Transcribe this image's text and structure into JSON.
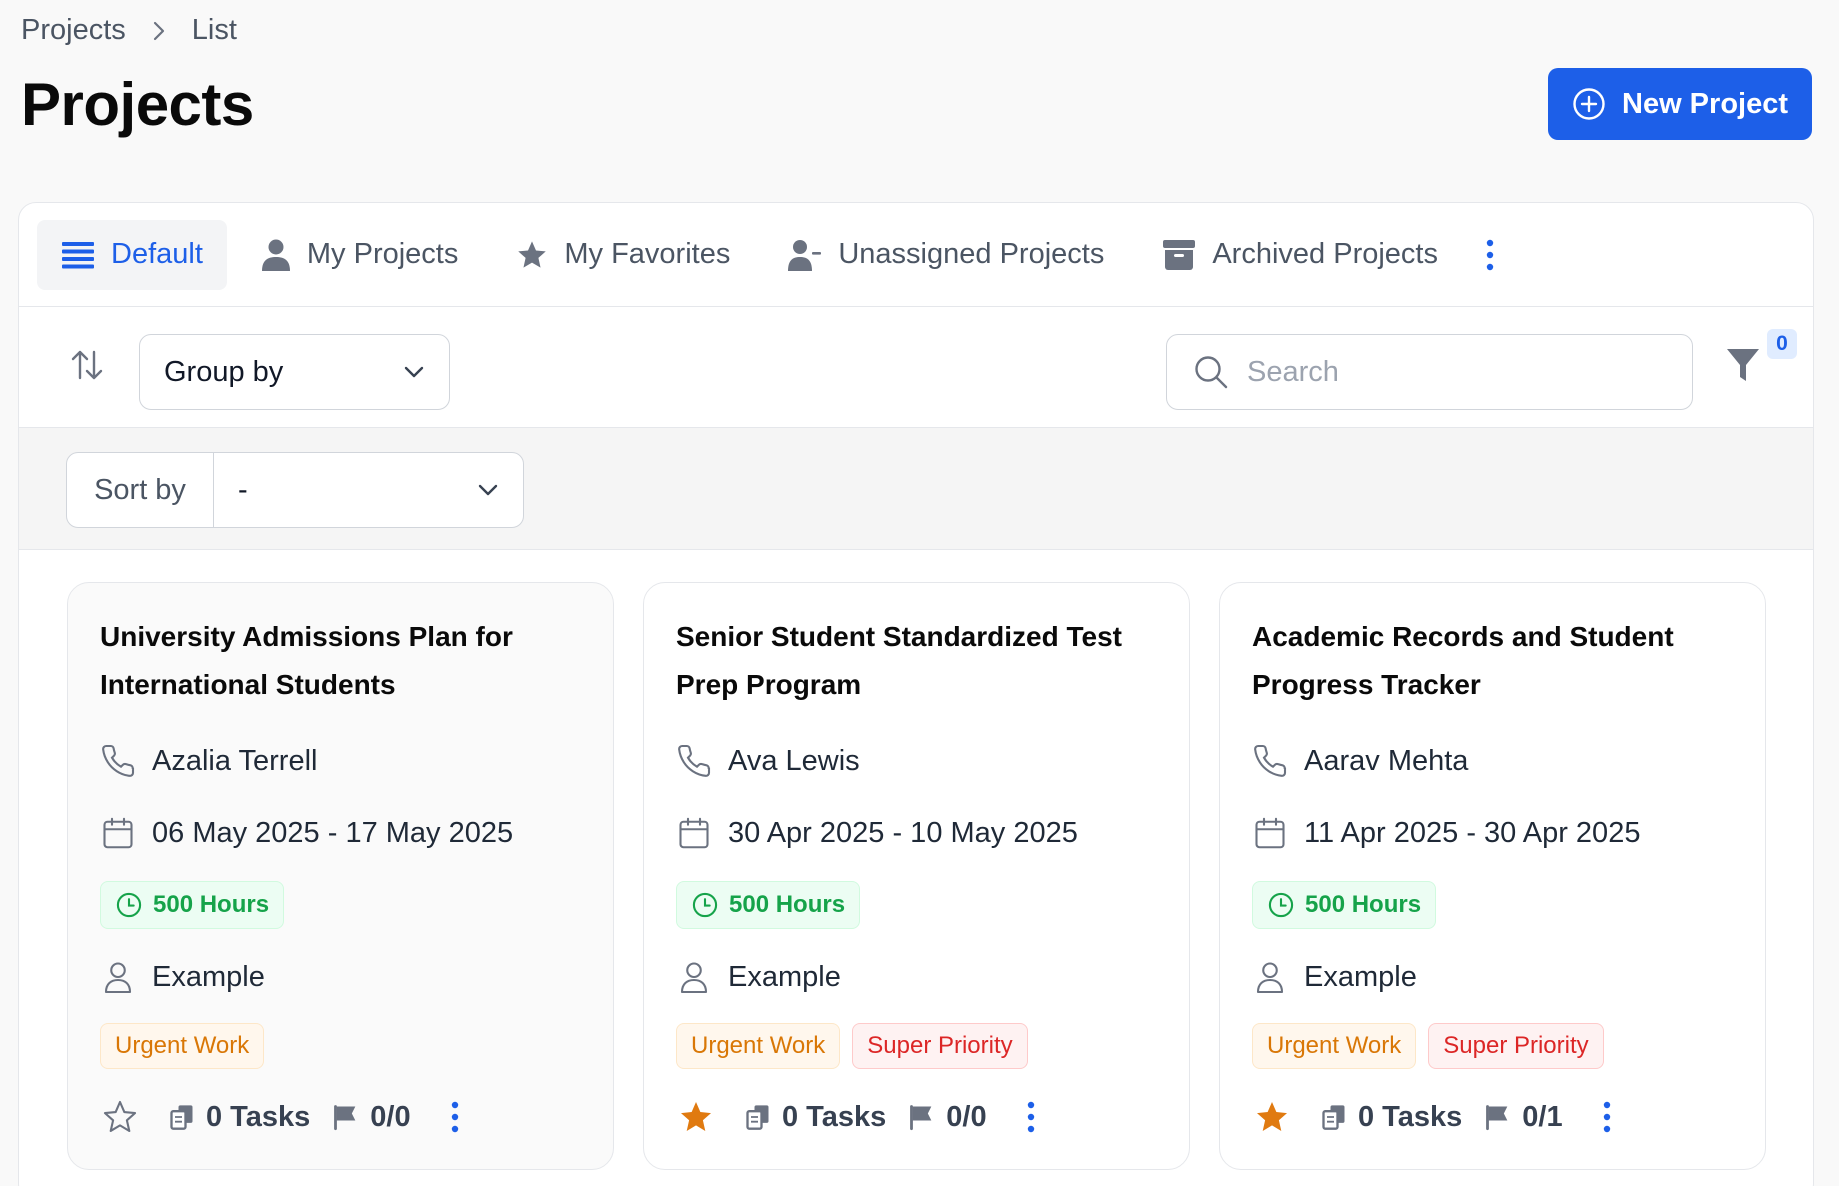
{
  "breadcrumb": {
    "items": [
      "Projects",
      "List"
    ]
  },
  "page": {
    "title": "Projects"
  },
  "actions": {
    "new_project_label": "New Project"
  },
  "tabs": [
    {
      "label": "Default",
      "icon": "list-icon",
      "active": true
    },
    {
      "label": "My Projects",
      "icon": "user-icon",
      "active": false
    },
    {
      "label": "My Favorites",
      "icon": "star-icon",
      "active": false
    },
    {
      "label": "Unassigned Projects",
      "icon": "user-minus-icon",
      "active": false
    },
    {
      "label": "Archived Projects",
      "icon": "archive-icon",
      "active": false
    }
  ],
  "toolbar": {
    "group_by_label": "Group by",
    "search_placeholder": "Search",
    "filter_count": "0",
    "sort_by_label": "Sort by",
    "sort_by_value": "-"
  },
  "colors": {
    "accent": "#1d5fe8",
    "favorite": "#e07a10",
    "hours_green": "#16a34a",
    "urgent": "#d97706",
    "super_priority": "#dc2626"
  },
  "cards": [
    {
      "title": "University Admissions Plan for International Students",
      "contact": "Azalia Terrell",
      "dates": "06 May 2025 - 17 May 2025",
      "hours": "500 Hours",
      "owner": "Example",
      "tags": [
        "Urgent Work"
      ],
      "favorite": false,
      "tasks": "0 Tasks",
      "milestones": "0/0"
    },
    {
      "title": "Senior Student Standardized Test Prep Program",
      "contact": "Ava Lewis",
      "dates": "30 Apr 2025 - 10 May 2025",
      "hours": "500 Hours",
      "owner": "Example",
      "tags": [
        "Urgent Work",
        "Super Priority"
      ],
      "favorite": true,
      "tasks": "0 Tasks",
      "milestones": "0/0"
    },
    {
      "title": "Academic Records and Student Progress Tracker",
      "contact": "Aarav Mehta",
      "dates": "11 Apr 2025 - 30 Apr 2025",
      "hours": "500 Hours",
      "owner": "Example",
      "tags": [
        "Urgent Work",
        "Super Priority"
      ],
      "favorite": true,
      "tasks": "0 Tasks",
      "milestones": "0/1"
    }
  ]
}
